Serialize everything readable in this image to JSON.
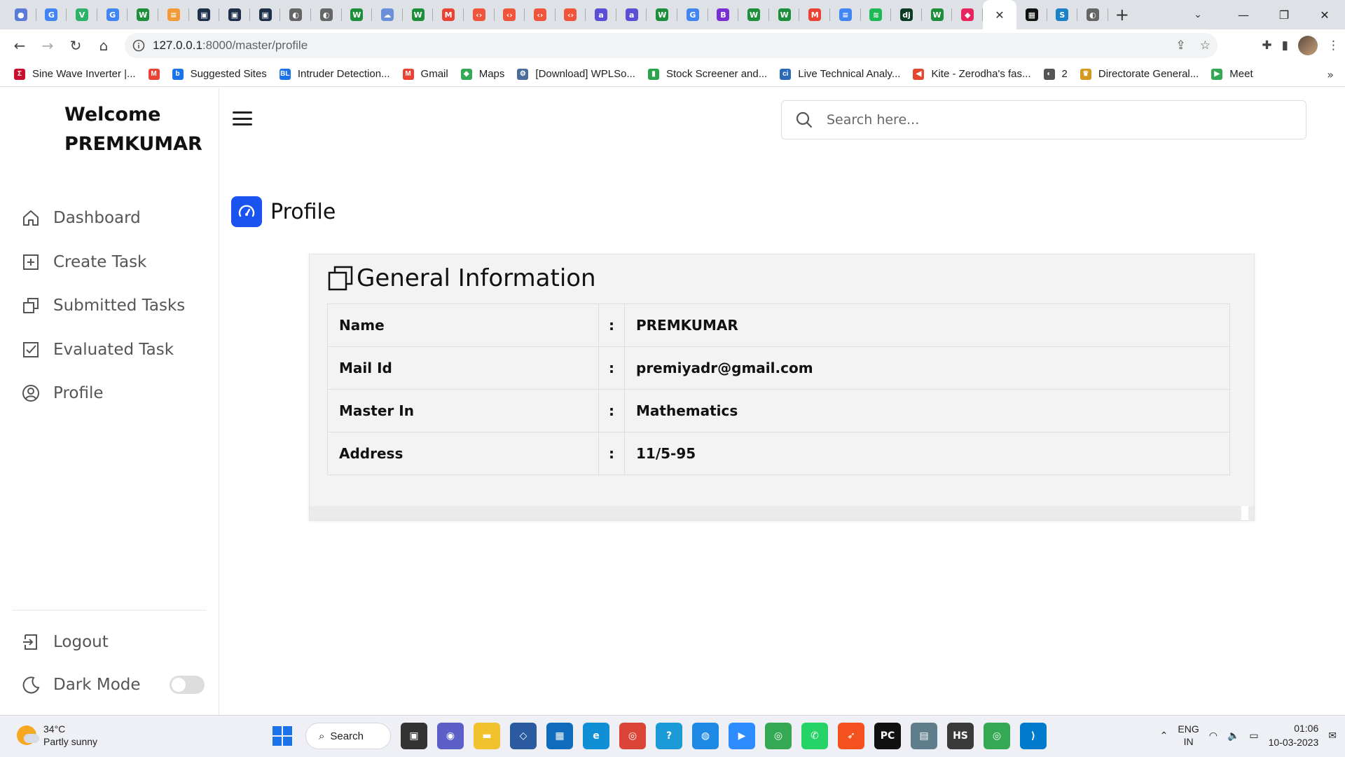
{
  "browser": {
    "url_host": "127.0.0.1",
    "url_path": ":8000/master/profile",
    "tab_close": "✕",
    "new_tab": "+"
  },
  "bookmarks": [
    {
      "label": "Sine Wave Inverter |...",
      "color": "#c8102e",
      "glyph": "Σ"
    },
    {
      "label": "",
      "color": "#ea4335",
      "glyph": "M"
    },
    {
      "label": "Suggested Sites",
      "color": "#1a73e8",
      "glyph": "b"
    },
    {
      "label": "Intruder Detection...",
      "color": "#1a73e8",
      "glyph": "BL"
    },
    {
      "label": "Gmail",
      "color": "#ea4335",
      "glyph": "M"
    },
    {
      "label": "Maps",
      "color": "#34a853",
      "glyph": "◆"
    },
    {
      "label": "[Download] WPLSo...",
      "color": "#4a6d9c",
      "glyph": "⚙"
    },
    {
      "label": "Stock Screener and...",
      "color": "#2aa54b",
      "glyph": "▮"
    },
    {
      "label": "Live Technical Analy...",
      "color": "#2a6ab8",
      "glyph": "ci"
    },
    {
      "label": "Kite - Zerodha's fas...",
      "color": "#e2492f",
      "glyph": "◀"
    },
    {
      "label": "2",
      "color": "#555555",
      "glyph": "◐"
    },
    {
      "label": "Directorate General...",
      "color": "#d49a1f",
      "glyph": "♛"
    },
    {
      "label": "Meet",
      "color": "#34a853",
      "glyph": "▶"
    }
  ],
  "sidebar": {
    "welcome_line1": "Welcome",
    "welcome_line2": "PREMKUMAR",
    "items": [
      {
        "label": "Dashboard"
      },
      {
        "label": "Create Task"
      },
      {
        "label": "Submitted Tasks"
      },
      {
        "label": "Evaluated Task"
      },
      {
        "label": "Profile"
      }
    ],
    "logout": "Logout",
    "dark_mode": "Dark Mode",
    "dark_mode_on": false
  },
  "header": {
    "search_placeholder": "Search here..."
  },
  "main": {
    "page_title": "Profile",
    "accent": "#1a54f0",
    "card_title": "General Information",
    "rows": [
      {
        "label": "Name",
        "sep": ":",
        "value": "PREMKUMAR"
      },
      {
        "label": "Mail Id",
        "sep": ":",
        "value": "premiyadr@gmail.com"
      },
      {
        "label": "Master In",
        "sep": ":",
        "value": "Mathematics"
      },
      {
        "label": "Address",
        "sep": ":",
        "value": "11/5-95"
      }
    ]
  },
  "taskbar": {
    "temp": "34°C",
    "weather": "Partly sunny",
    "search_label": "Search",
    "lang1": "ENG",
    "lang2": "IN",
    "time": "01:06",
    "date": "10-03-2023"
  }
}
